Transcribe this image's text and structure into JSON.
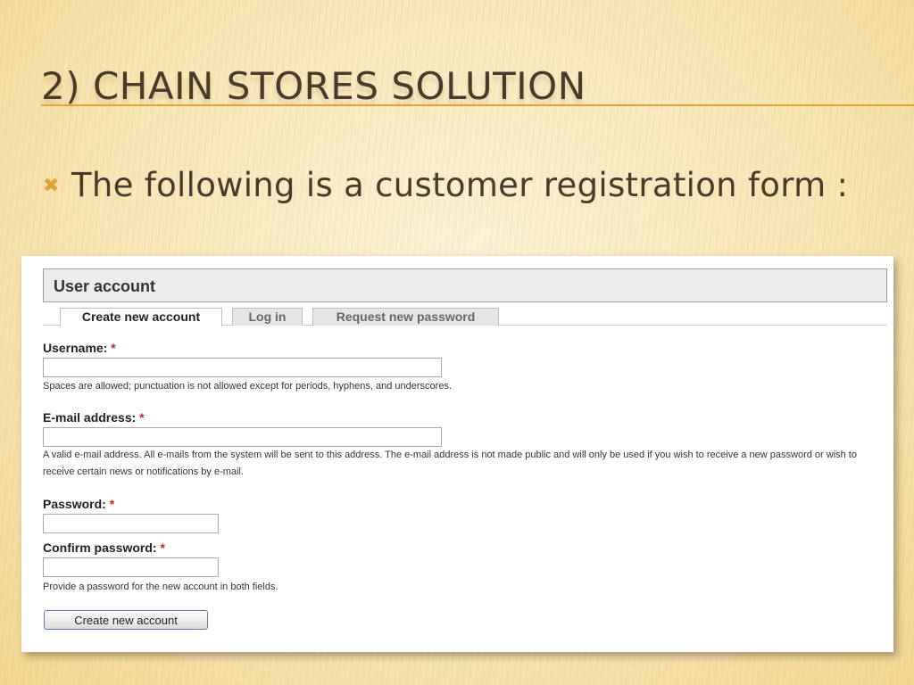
{
  "slide": {
    "title": "2) CHAIN STORES SOLUTION",
    "bullet_icon": "cross-bullet-icon",
    "bullet_text": "The following is a customer registration form :",
    "accent_color": "#e0a33a",
    "text_color": "#4a3a2a"
  },
  "form": {
    "header_title": "User account",
    "tabs": [
      {
        "label": "Create new account",
        "active": true
      },
      {
        "label": "Log in",
        "active": false
      },
      {
        "label": "Request new password",
        "active": false
      }
    ],
    "required_marker": "*",
    "username": {
      "label": "Username:",
      "value": "",
      "description": "Spaces are allowed; punctuation is not allowed except for periods, hyphens, and underscores."
    },
    "email": {
      "label": "E-mail address:",
      "value": "",
      "description": "A valid e-mail address. All e-mails from the system will be sent to this address. The e-mail address is not made public and will only be used if you wish to receive a new password or wish to receive certain news or notifications by e-mail."
    },
    "password": {
      "label": "Password:",
      "value": ""
    },
    "confirm_password": {
      "label": "Confirm password:",
      "value": "",
      "description": "Provide a password for the new account in both fields."
    },
    "submit_label": "Create new account",
    "required_color": "#cc2222"
  }
}
